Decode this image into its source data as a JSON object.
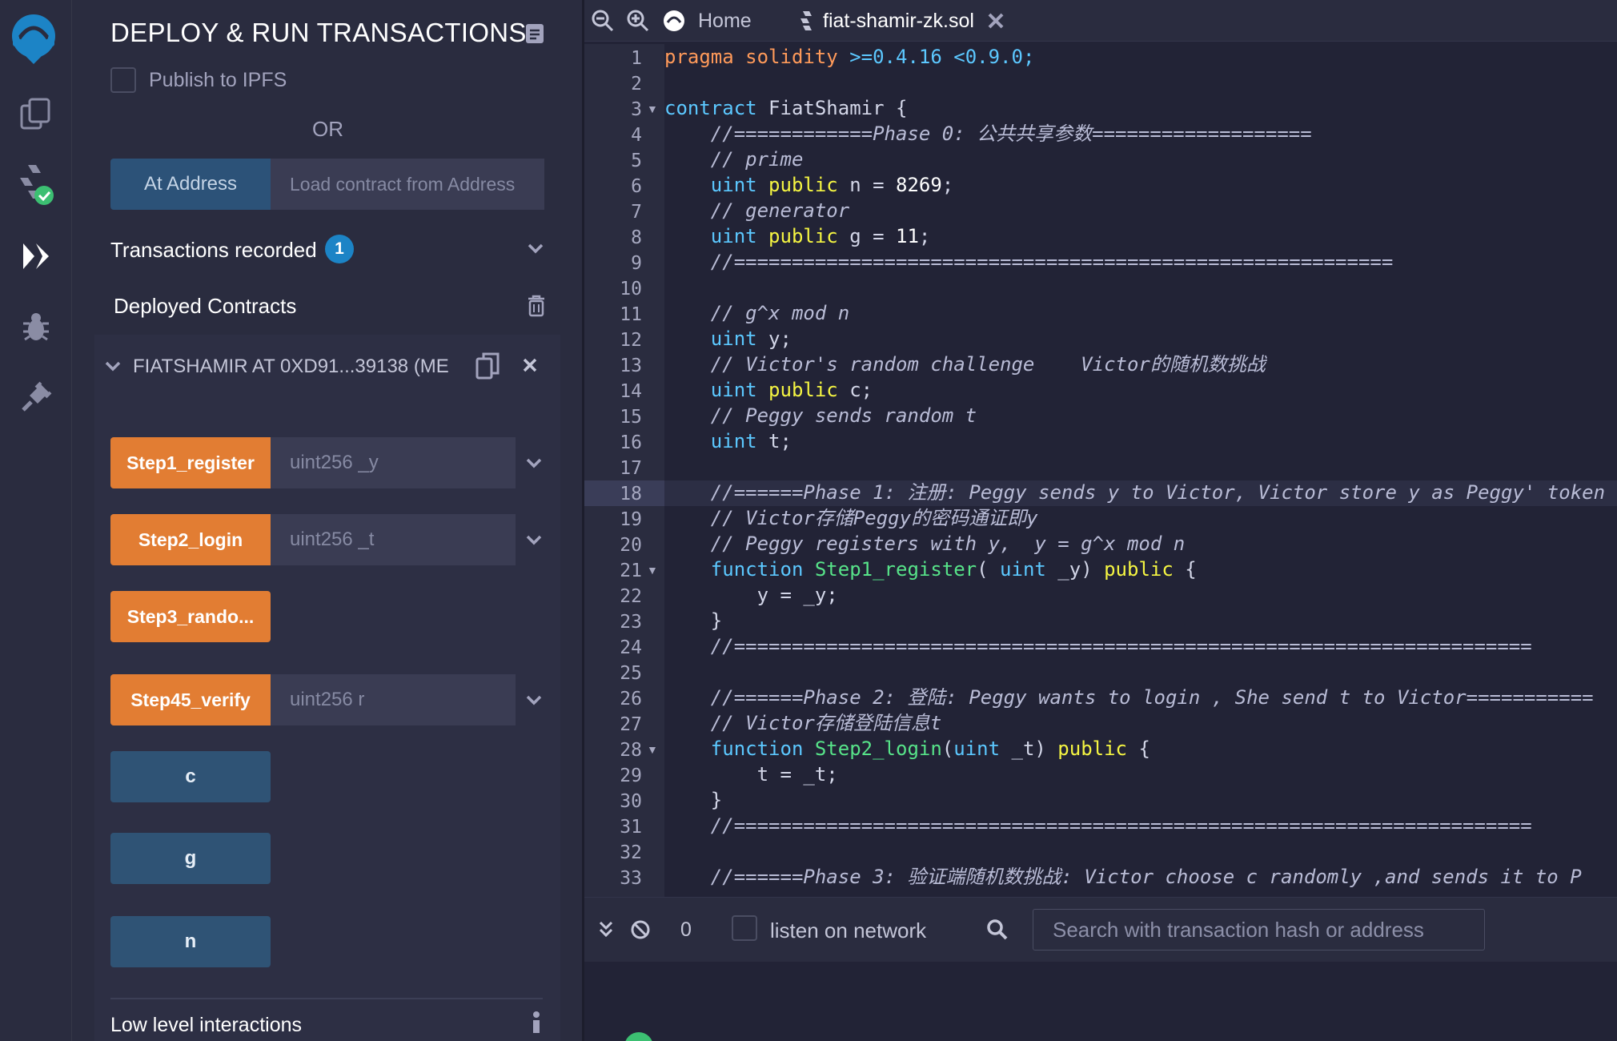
{
  "panel": {
    "title": "DEPLOY & RUN TRANSACTIONS",
    "publish_label": "Publish to IPFS",
    "or_label": "OR",
    "at_address_label": "At Address",
    "at_address_placeholder": "Load contract from Address",
    "transactions_recorded_label": "Transactions recorded",
    "transactions_count": "1",
    "deployed_contracts_label": "Deployed Contracts",
    "instance_title": "FIATSHAMIR AT 0XD91...39138 (ME",
    "functions": [
      {
        "label": "Step1_register",
        "param": "uint256 _y"
      },
      {
        "label": "Step2_login",
        "param": "uint256 _t"
      },
      {
        "label": "Step3_rando..."
      },
      {
        "label": "Step45_verify",
        "param": "uint256 r"
      }
    ],
    "getters": [
      "c",
      "g",
      "n"
    ],
    "low_level_label": "Low level interactions"
  },
  "editor": {
    "home_tab": "Home",
    "file_tab": "fiat-shamir-zk.sol",
    "line_numbers": [
      "1",
      "2",
      "3",
      "4",
      "5",
      "6",
      "7",
      "8",
      "9",
      "10",
      "11",
      "12",
      "13",
      "14",
      "15",
      "16",
      "17",
      "18",
      "19",
      "20",
      "21",
      "22",
      "23",
      "24",
      "25",
      "26",
      "27",
      "28",
      "29",
      "30",
      "31",
      "32",
      "33"
    ],
    "code": {
      "l1": [
        "pragma solidity",
        " >=0.4.16 <0.9.0;"
      ],
      "l3": [
        "contract",
        " FiatShamir {"
      ],
      "l4": "    //============Phase 0: 公共共享参数===================",
      "l5": "    // prime",
      "l6": [
        "    ",
        "uint",
        " ",
        "public",
        " n = ",
        "8269",
        ";"
      ],
      "l7": "    // generator",
      "l8": [
        "    ",
        "uint",
        " ",
        "public",
        " g = ",
        "11",
        ";"
      ],
      "l9": "    //=========================================================",
      "l11": "    // g^x mod n",
      "l12": [
        "    ",
        "uint",
        " y;"
      ],
      "l13": "    // Victor's random challenge    Victor的随机数挑战",
      "l14": [
        "    ",
        "uint",
        " ",
        "public",
        " c;"
      ],
      "l15": "    // Peggy sends random t",
      "l16": [
        "    ",
        "uint",
        " t;"
      ],
      "l18": "    //======Phase 1: 注册: Peggy sends y to Victor, Victor store y as Peggy' token",
      "l19": "    // Victor存储Peggy的密码通证即y",
      "l20": "    // Peggy registers with y,  y = g^x mod n",
      "l21": [
        "    ",
        "function",
        " ",
        "Step1_register",
        "( ",
        "uint",
        " _y) ",
        "public",
        " {"
      ],
      "l22": "        y = _y;",
      "l23": "    }",
      "l24": "    //=====================================================================",
      "l26": "    //======Phase 2: 登陆: Peggy wants to login , She send t to Victor===========",
      "l27": "    // Victor存储登陆信息t",
      "l28": [
        "    ",
        "function",
        " ",
        "Step2_login",
        "(",
        "uint",
        " _t) ",
        "public",
        " {"
      ],
      "l29": "        t = _t;",
      "l30": "    }",
      "l31": "    //=====================================================================",
      "l33": "    //======Phase 3: 验证端随机数挑战: Victor choose c randomly ,and sends it to P"
    }
  },
  "terminal": {
    "count": "0",
    "listen_label": "listen on network",
    "search_placeholder": "Search with transaction hash or address"
  }
}
